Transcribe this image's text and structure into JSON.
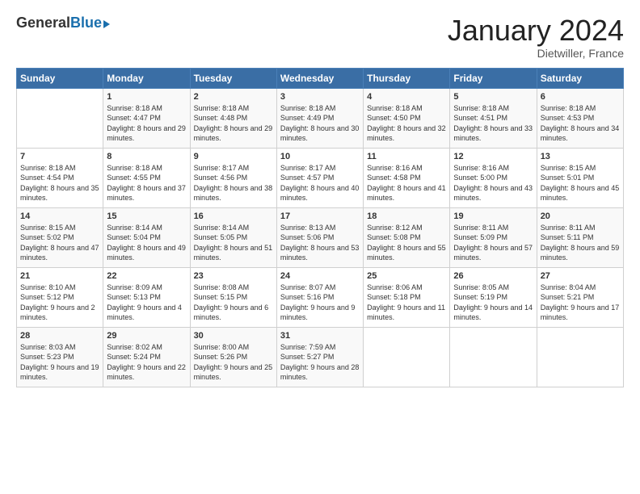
{
  "header": {
    "logo_general": "General",
    "logo_blue": "Blue",
    "month": "January 2024",
    "location": "Dietwiller, France"
  },
  "days_of_week": [
    "Sunday",
    "Monday",
    "Tuesday",
    "Wednesday",
    "Thursday",
    "Friday",
    "Saturday"
  ],
  "weeks": [
    [
      {
        "day": "",
        "sunrise": "",
        "sunset": "",
        "daylight": ""
      },
      {
        "day": "1",
        "sunrise": "Sunrise: 8:18 AM",
        "sunset": "Sunset: 4:47 PM",
        "daylight": "Daylight: 8 hours and 29 minutes."
      },
      {
        "day": "2",
        "sunrise": "Sunrise: 8:18 AM",
        "sunset": "Sunset: 4:48 PM",
        "daylight": "Daylight: 8 hours and 29 minutes."
      },
      {
        "day": "3",
        "sunrise": "Sunrise: 8:18 AM",
        "sunset": "Sunset: 4:49 PM",
        "daylight": "Daylight: 8 hours and 30 minutes."
      },
      {
        "day": "4",
        "sunrise": "Sunrise: 8:18 AM",
        "sunset": "Sunset: 4:50 PM",
        "daylight": "Daylight: 8 hours and 32 minutes."
      },
      {
        "day": "5",
        "sunrise": "Sunrise: 8:18 AM",
        "sunset": "Sunset: 4:51 PM",
        "daylight": "Daylight: 8 hours and 33 minutes."
      },
      {
        "day": "6",
        "sunrise": "Sunrise: 8:18 AM",
        "sunset": "Sunset: 4:53 PM",
        "daylight": "Daylight: 8 hours and 34 minutes."
      }
    ],
    [
      {
        "day": "7",
        "sunrise": "Sunrise: 8:18 AM",
        "sunset": "Sunset: 4:54 PM",
        "daylight": "Daylight: 8 hours and 35 minutes."
      },
      {
        "day": "8",
        "sunrise": "Sunrise: 8:18 AM",
        "sunset": "Sunset: 4:55 PM",
        "daylight": "Daylight: 8 hours and 37 minutes."
      },
      {
        "day": "9",
        "sunrise": "Sunrise: 8:17 AM",
        "sunset": "Sunset: 4:56 PM",
        "daylight": "Daylight: 8 hours and 38 minutes."
      },
      {
        "day": "10",
        "sunrise": "Sunrise: 8:17 AM",
        "sunset": "Sunset: 4:57 PM",
        "daylight": "Daylight: 8 hours and 40 minutes."
      },
      {
        "day": "11",
        "sunrise": "Sunrise: 8:16 AM",
        "sunset": "Sunset: 4:58 PM",
        "daylight": "Daylight: 8 hours and 41 minutes."
      },
      {
        "day": "12",
        "sunrise": "Sunrise: 8:16 AM",
        "sunset": "Sunset: 5:00 PM",
        "daylight": "Daylight: 8 hours and 43 minutes."
      },
      {
        "day": "13",
        "sunrise": "Sunrise: 8:15 AM",
        "sunset": "Sunset: 5:01 PM",
        "daylight": "Daylight: 8 hours and 45 minutes."
      }
    ],
    [
      {
        "day": "14",
        "sunrise": "Sunrise: 8:15 AM",
        "sunset": "Sunset: 5:02 PM",
        "daylight": "Daylight: 8 hours and 47 minutes."
      },
      {
        "day": "15",
        "sunrise": "Sunrise: 8:14 AM",
        "sunset": "Sunset: 5:04 PM",
        "daylight": "Daylight: 8 hours and 49 minutes."
      },
      {
        "day": "16",
        "sunrise": "Sunrise: 8:14 AM",
        "sunset": "Sunset: 5:05 PM",
        "daylight": "Daylight: 8 hours and 51 minutes."
      },
      {
        "day": "17",
        "sunrise": "Sunrise: 8:13 AM",
        "sunset": "Sunset: 5:06 PM",
        "daylight": "Daylight: 8 hours and 53 minutes."
      },
      {
        "day": "18",
        "sunrise": "Sunrise: 8:12 AM",
        "sunset": "Sunset: 5:08 PM",
        "daylight": "Daylight: 8 hours and 55 minutes."
      },
      {
        "day": "19",
        "sunrise": "Sunrise: 8:11 AM",
        "sunset": "Sunset: 5:09 PM",
        "daylight": "Daylight: 8 hours and 57 minutes."
      },
      {
        "day": "20",
        "sunrise": "Sunrise: 8:11 AM",
        "sunset": "Sunset: 5:11 PM",
        "daylight": "Daylight: 8 hours and 59 minutes."
      }
    ],
    [
      {
        "day": "21",
        "sunrise": "Sunrise: 8:10 AM",
        "sunset": "Sunset: 5:12 PM",
        "daylight": "Daylight: 9 hours and 2 minutes."
      },
      {
        "day": "22",
        "sunrise": "Sunrise: 8:09 AM",
        "sunset": "Sunset: 5:13 PM",
        "daylight": "Daylight: 9 hours and 4 minutes."
      },
      {
        "day": "23",
        "sunrise": "Sunrise: 8:08 AM",
        "sunset": "Sunset: 5:15 PM",
        "daylight": "Daylight: 9 hours and 6 minutes."
      },
      {
        "day": "24",
        "sunrise": "Sunrise: 8:07 AM",
        "sunset": "Sunset: 5:16 PM",
        "daylight": "Daylight: 9 hours and 9 minutes."
      },
      {
        "day": "25",
        "sunrise": "Sunrise: 8:06 AM",
        "sunset": "Sunset: 5:18 PM",
        "daylight": "Daylight: 9 hours and 11 minutes."
      },
      {
        "day": "26",
        "sunrise": "Sunrise: 8:05 AM",
        "sunset": "Sunset: 5:19 PM",
        "daylight": "Daylight: 9 hours and 14 minutes."
      },
      {
        "day": "27",
        "sunrise": "Sunrise: 8:04 AM",
        "sunset": "Sunset: 5:21 PM",
        "daylight": "Daylight: 9 hours and 17 minutes."
      }
    ],
    [
      {
        "day": "28",
        "sunrise": "Sunrise: 8:03 AM",
        "sunset": "Sunset: 5:23 PM",
        "daylight": "Daylight: 9 hours and 19 minutes."
      },
      {
        "day": "29",
        "sunrise": "Sunrise: 8:02 AM",
        "sunset": "Sunset: 5:24 PM",
        "daylight": "Daylight: 9 hours and 22 minutes."
      },
      {
        "day": "30",
        "sunrise": "Sunrise: 8:00 AM",
        "sunset": "Sunset: 5:26 PM",
        "daylight": "Daylight: 9 hours and 25 minutes."
      },
      {
        "day": "31",
        "sunrise": "Sunrise: 7:59 AM",
        "sunset": "Sunset: 5:27 PM",
        "daylight": "Daylight: 9 hours and 28 minutes."
      },
      {
        "day": "",
        "sunrise": "",
        "sunset": "",
        "daylight": ""
      },
      {
        "day": "",
        "sunrise": "",
        "sunset": "",
        "daylight": ""
      },
      {
        "day": "",
        "sunrise": "",
        "sunset": "",
        "daylight": ""
      }
    ]
  ]
}
